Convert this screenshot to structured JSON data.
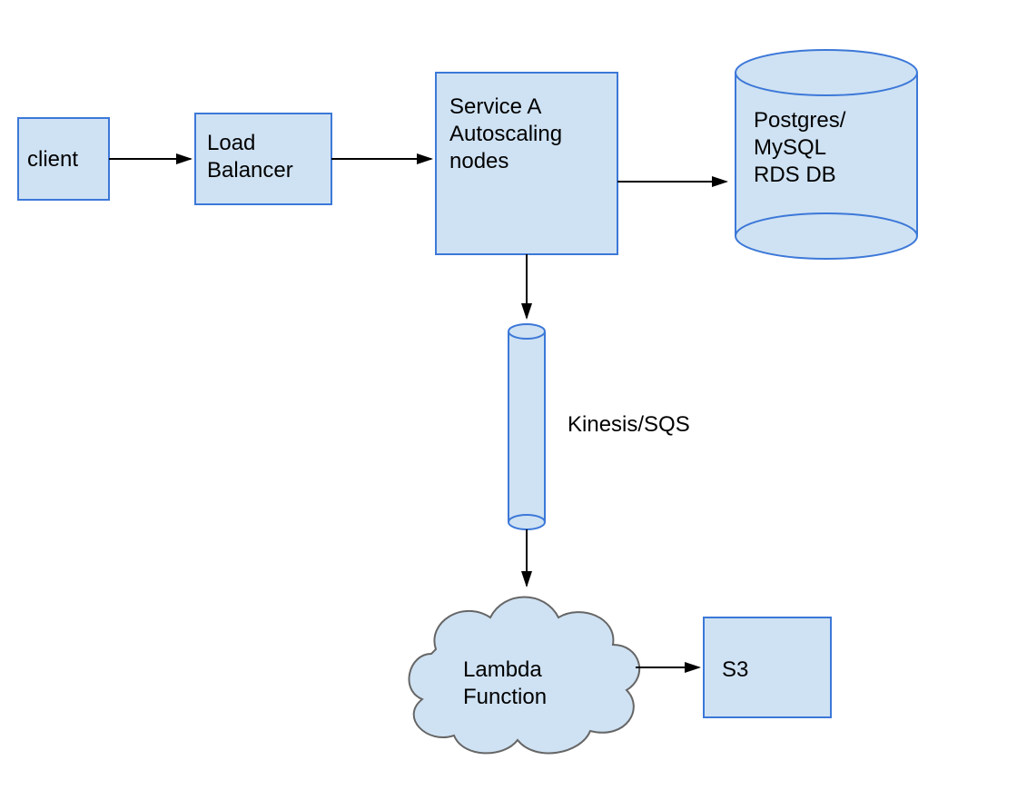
{
  "colors": {
    "node_fill": "#cfe2f3",
    "node_stroke": "#3c78d8",
    "cloud_stroke": "#666666",
    "arrow_stroke": "#000000"
  },
  "nodes": {
    "client": {
      "label": "client"
    },
    "load_balancer": {
      "label_line1": "Load",
      "label_line2": "Balancer"
    },
    "service_a": {
      "label_line1": "Service A",
      "label_line2": "Autoscaling",
      "label_line3": "nodes"
    },
    "db": {
      "label_line1": "Postgres/",
      "label_line2": "MySQL",
      "label_line3": "RDS DB"
    },
    "queue": {
      "side_label": "Kinesis/SQS"
    },
    "lambda": {
      "label_line1": "Lambda",
      "label_line2": "Function"
    },
    "s3": {
      "label": "S3"
    }
  },
  "edges": [
    {
      "from": "client",
      "to": "load_balancer"
    },
    {
      "from": "load_balancer",
      "to": "service_a"
    },
    {
      "from": "service_a",
      "to": "db"
    },
    {
      "from": "service_a",
      "to": "queue"
    },
    {
      "from": "queue",
      "to": "lambda"
    },
    {
      "from": "lambda",
      "to": "s3"
    }
  ]
}
